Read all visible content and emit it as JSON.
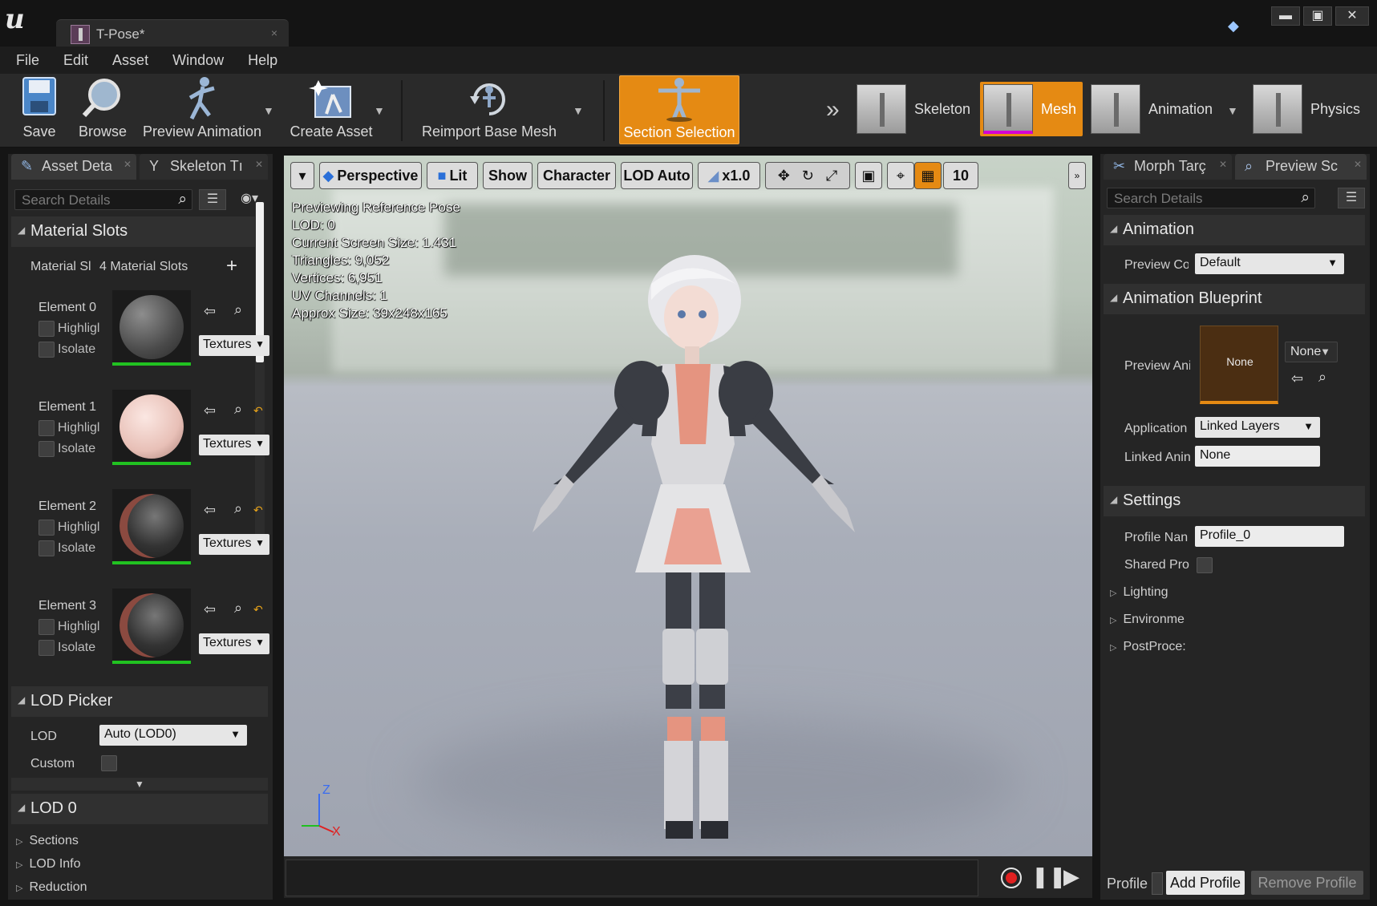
{
  "window": {
    "tab_title": "T-Pose*",
    "tab_close": "×",
    "min_glyph": "▬",
    "max_glyph": "▣",
    "close_glyph": "✕"
  },
  "menu": [
    "File",
    "Edit",
    "Asset",
    "Window",
    "Help"
  ],
  "toolbar": {
    "save": "Save",
    "browse": "Browse",
    "preview_animation": "Preview Animation",
    "create_asset": "Create Asset",
    "reimport": "Reimport Base Mesh",
    "section_selection": "Section Selection",
    "modes": {
      "skeleton": "Skeleton",
      "mesh": "Mesh",
      "animation": "Animation",
      "physics": "Physics"
    },
    "accent_color": "#e58a13"
  },
  "left_panel": {
    "tab_asset": "Asset Deta",
    "tab_skeleton": "Skeleton Tı",
    "search_placeholder": "Search Details",
    "material_slots": {
      "title": "Material Slots",
      "label": "Material Sl",
      "value": "4 Material Slots"
    },
    "elements": [
      {
        "label": "Element 0",
        "highlight": "Highligl",
        "isolate": "Isolate",
        "textures": "Textures"
      },
      {
        "label": "Element 1",
        "highlight": "Highligl",
        "isolate": "Isolate",
        "textures": "Textures"
      },
      {
        "label": "Element 2",
        "highlight": "Highligl",
        "isolate": "Isolate",
        "textures": "Textures"
      },
      {
        "label": "Element 3",
        "highlight": "Highligl",
        "isolate": "Isolate",
        "textures": "Textures"
      }
    ],
    "lod_picker": {
      "title": "LOD Picker",
      "lod_label": "LOD",
      "lod_value": "Auto (LOD0)",
      "custom_label": "Custom"
    },
    "lod0": {
      "title": "LOD 0",
      "sections": "Sections",
      "lod_info": "LOD Info",
      "reduction": "Reduction"
    }
  },
  "viewport": {
    "buttons": {
      "perspective": "Perspective",
      "lit": "Lit",
      "show": "Show",
      "character": "Character",
      "lod": "LOD Auto",
      "speed": "x1.0",
      "grid_size": "10"
    },
    "stats": [
      "Previewing Reference Pose",
      "LOD: 0",
      "Current Screen Size: 1.431",
      "Triangles: 9,052",
      "Vertices: 6,951",
      "UV Channels: 1",
      "Approx Size: 39x248x165"
    ],
    "axis": {
      "z": "Z",
      "x": "X"
    }
  },
  "right_panel": {
    "tab_morph": "Morph Tarç",
    "tab_preview": "Preview Sc",
    "search_placeholder": "Search Details",
    "animation": {
      "title": "Animation",
      "preview_label": "Preview Co",
      "preview_value": "Default"
    },
    "anim_blueprint": {
      "title": "Animation Blueprint",
      "preview_label": "Preview Ani",
      "thumb_text": "None",
      "combo_value": "None",
      "application_label": "Application",
      "application_value": "Linked Layers",
      "linked_label": "Linked Anin",
      "linked_value": "None"
    },
    "settings": {
      "title": "Settings",
      "profile_label": "Profile Nan",
      "profile_value": "Profile_0",
      "shared_label": "Shared Pro",
      "lighting": "Lighting",
      "environment": "Environme",
      "postprocess": "PostProce:"
    },
    "footer": {
      "profile_label": "Profile",
      "add_profile": "Add Profile",
      "remove_profile": "Remove Profile"
    }
  }
}
